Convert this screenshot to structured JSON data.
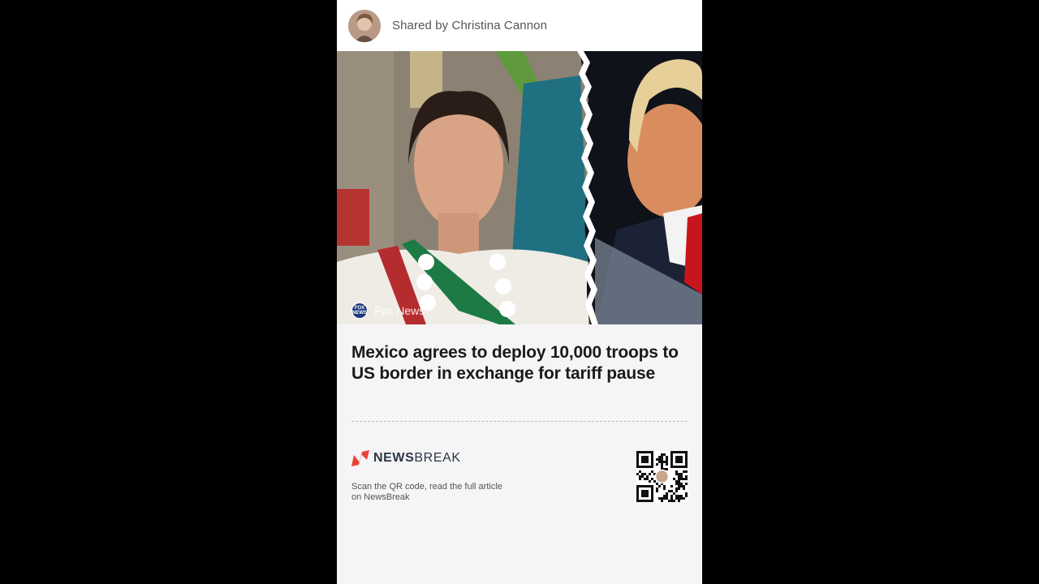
{
  "share": {
    "text": "Shared by Christina Cannon"
  },
  "article": {
    "source_logo_text": "FOX NEWS",
    "source": "Fox News",
    "headline": "Mexico agrees to deploy 10,000 troops to US border in exchange for tariff pause"
  },
  "newsbreak": {
    "brand_strong": "NEWS",
    "brand_light": "BREAK",
    "cta": "Scan the QR code, read the full article on NewsBreak"
  },
  "colors": {
    "background": "#000000",
    "card": "#f5f4f6",
    "brand_red": "#e8423a",
    "brand_text": "#2b3644"
  },
  "icons": [
    "newsbreak-logo-icon",
    "fox-news-logo-icon",
    "qr-code-icon",
    "avatar"
  ]
}
